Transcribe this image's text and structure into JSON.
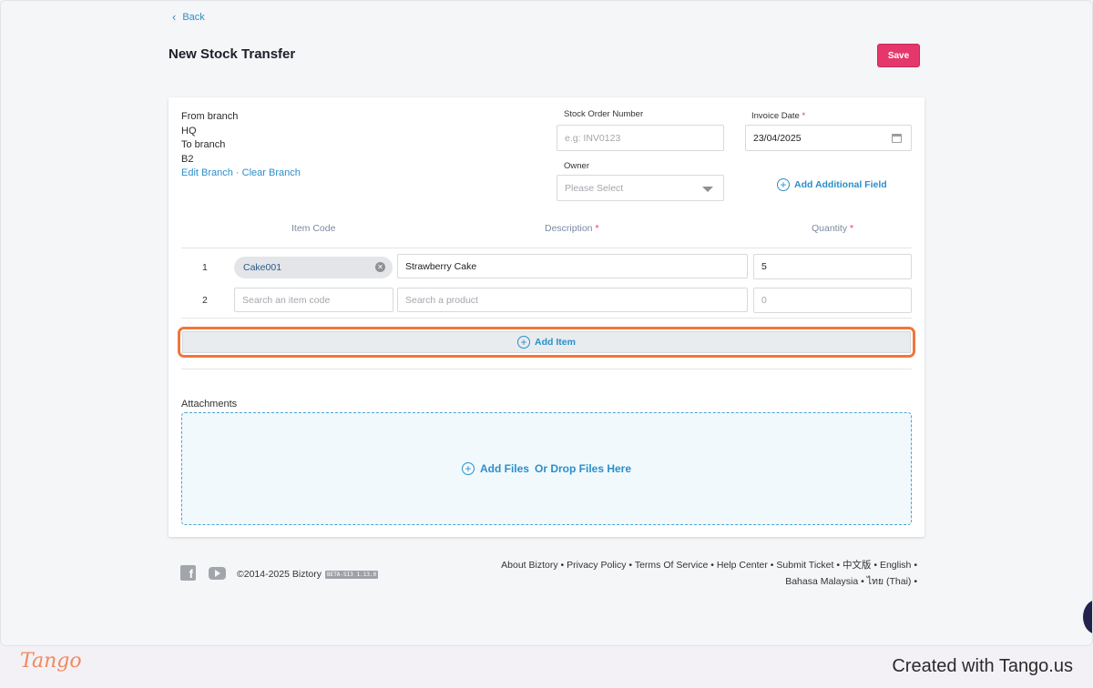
{
  "nav": {
    "back_label": "Back"
  },
  "page": {
    "title": "New Stock Transfer",
    "save_label": "Save"
  },
  "branch": {
    "from_label": "From branch",
    "from_value": "HQ",
    "to_label": "To branch",
    "to_value": "B2",
    "edit_label": "Edit Branch",
    "separator": " · ",
    "clear_label": "Clear Branch"
  },
  "fields": {
    "stock_order_label": "Stock Order Number",
    "stock_order_placeholder": "e.g: INV0123",
    "invoice_date_label": "Invoice Date",
    "invoice_date_value": "23/04/2025",
    "owner_label": "Owner",
    "owner_value": "Please Select",
    "add_field_label": "Add Additional Field",
    "required_mark": "*"
  },
  "table": {
    "headers": {
      "item_code": "Item Code",
      "description": "Description",
      "quantity": "Quantity"
    },
    "rows": [
      {
        "num": "1",
        "item_code": "Cake001",
        "description": "Strawberry Cake",
        "quantity": "5"
      },
      {
        "num": "2",
        "item_code_placeholder": "Search an item code",
        "description_placeholder": "Search a product",
        "quantity_placeholder": "0"
      }
    ],
    "add_item_label": "Add Item"
  },
  "attachments": {
    "label": "Attachments",
    "add_files_label": "Add Files",
    "drop_label": "Or Drop Files Here"
  },
  "footer": {
    "copyright": "©2014-2025 Biztory",
    "version": "BETA-SI3 1.13.0",
    "links_line1": [
      "About Biztory",
      "Privacy Policy",
      "Terms Of Service",
      "Help Center",
      "Submit Ticket",
      "中文版",
      "English"
    ],
    "links_line2": [
      "Bahasa Malaysia",
      "ไทย (Thai)"
    ],
    "bullet": " • "
  },
  "branding": {
    "logo": "Tango",
    "created_with": "Created with Tango.us"
  },
  "icons": {
    "back": "chevron-left-icon",
    "calendar": "calendar-icon",
    "add": "plus-circle-icon",
    "clear": "close-circle-icon",
    "facebook": "facebook-icon",
    "youtube": "youtube-icon"
  },
  "colors": {
    "accent": "#2a8fc9",
    "save": "#e5376b",
    "highlight": "#f0763b"
  }
}
